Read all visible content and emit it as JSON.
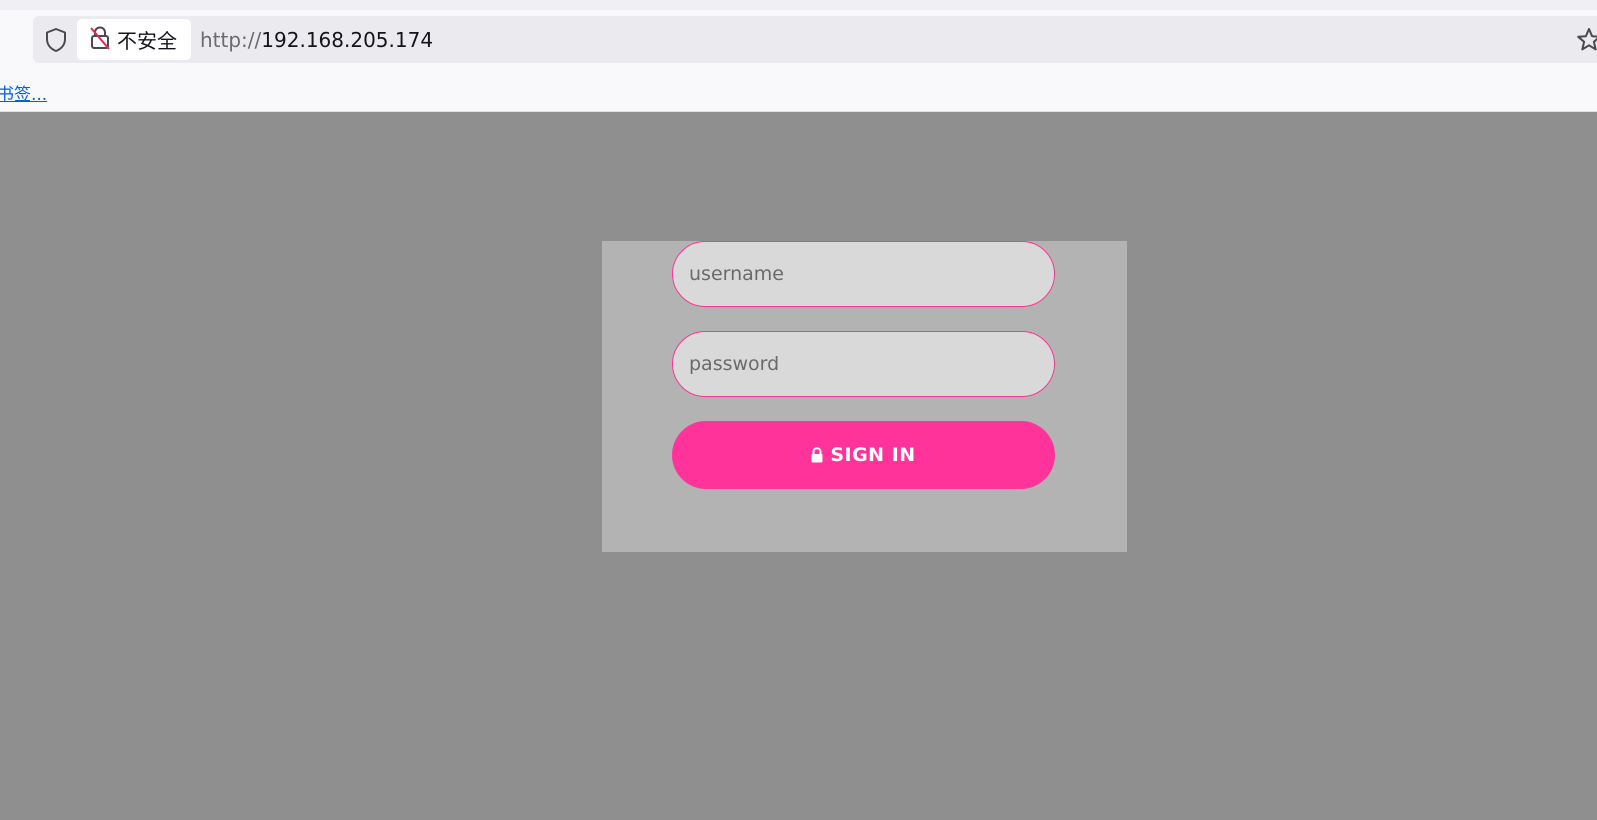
{
  "browser": {
    "security_label": "不安全",
    "url_scheme": "http://",
    "url_host": "192.168.205.174",
    "bookmarks_link": "书签..."
  },
  "login": {
    "username_placeholder": "username",
    "password_placeholder": "password",
    "signin_label": "SIGN IN"
  },
  "icons": {
    "shield": "shield-icon",
    "insecure_lock": "insecure-lock-icon",
    "star": "star-icon",
    "lock": "lock-icon"
  },
  "colors": {
    "accent": "#ff3399",
    "page_bg": "#8f8f8f",
    "card_bg": "#b3b3b3",
    "field_bg": "#d9d9d9"
  }
}
